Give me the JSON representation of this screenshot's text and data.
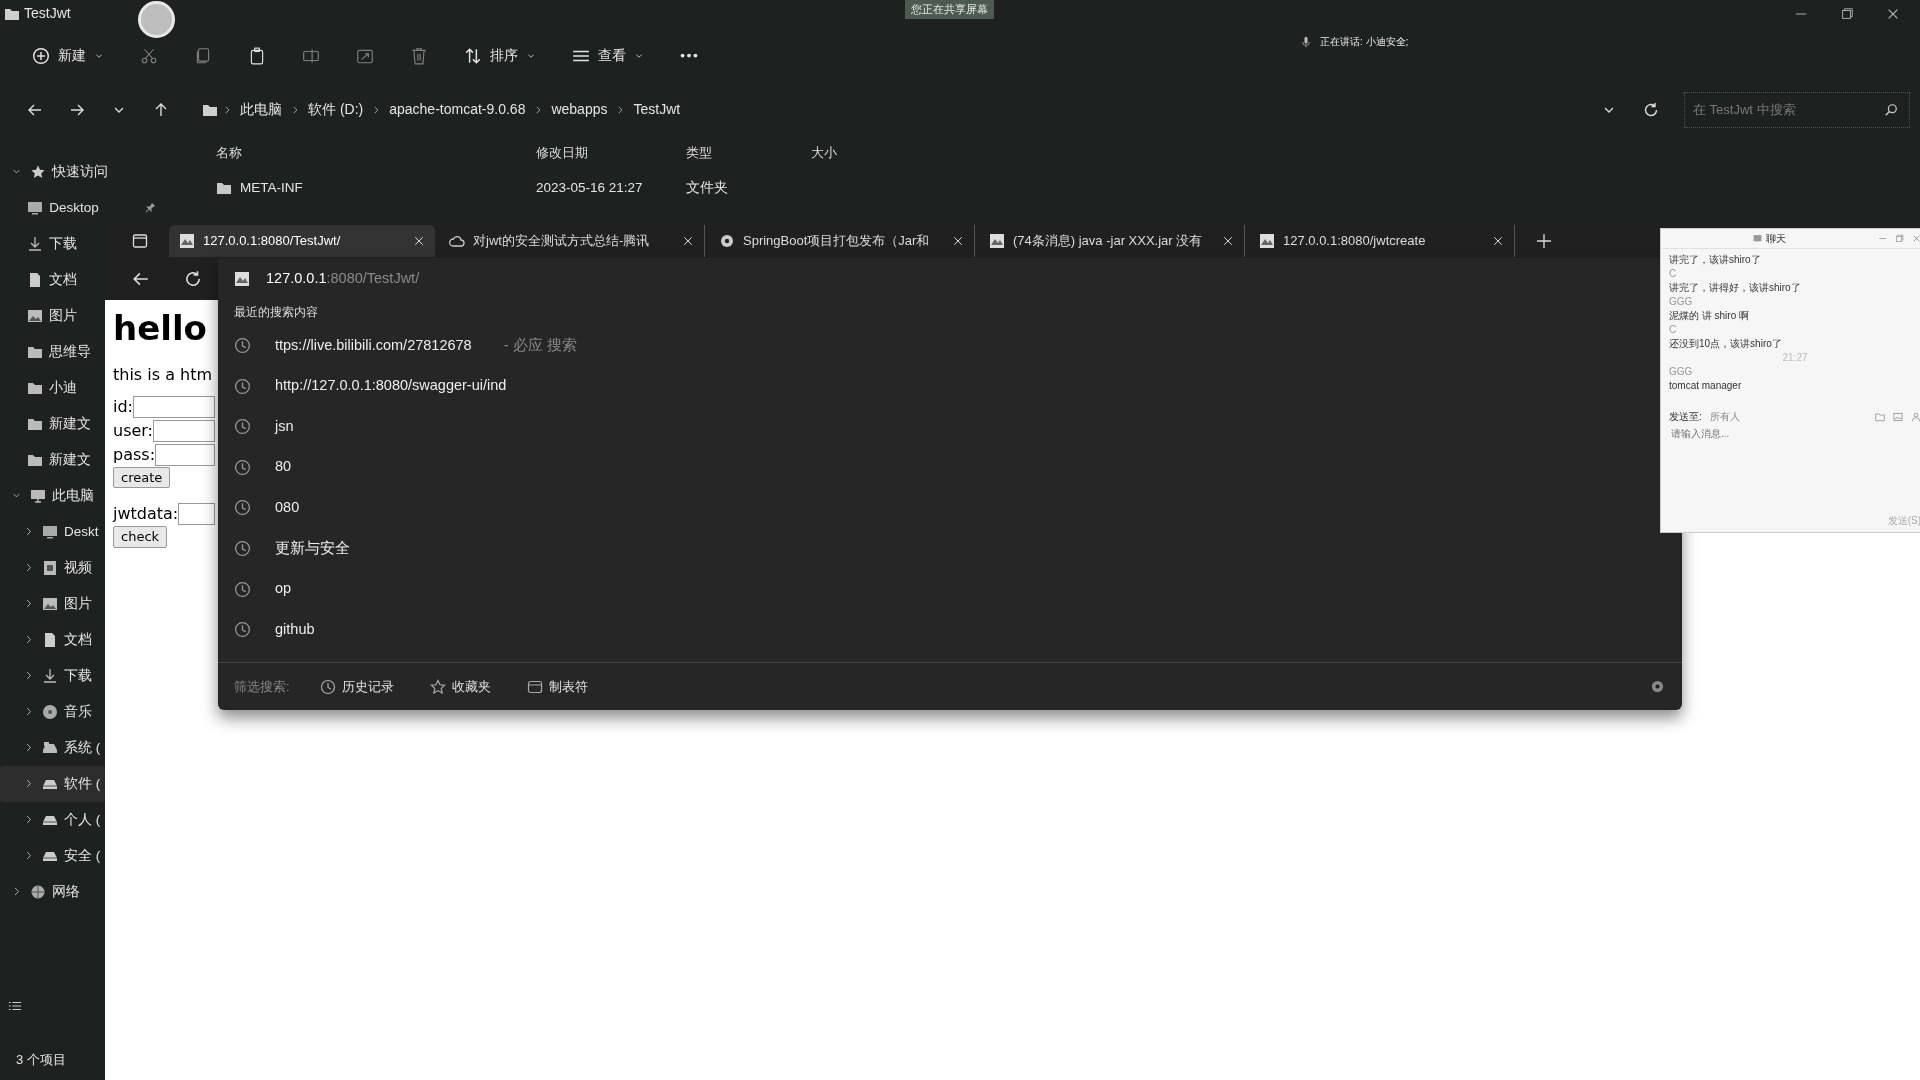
{
  "explorer": {
    "title": "TestJwt",
    "toolbar": [
      {
        "kind": "new",
        "label": "新建",
        "disabled": false
      },
      {
        "kind": "cut",
        "disabled": true
      },
      {
        "kind": "copy",
        "disabled": true
      },
      {
        "kind": "paste",
        "disabled": false
      },
      {
        "kind": "rename",
        "disabled": true
      },
      {
        "kind": "share",
        "disabled": true
      },
      {
        "kind": "delete",
        "disabled": true
      },
      {
        "kind": "sort",
        "label": "排序",
        "disabled": false
      },
      {
        "kind": "view",
        "label": "查看",
        "disabled": false
      },
      {
        "kind": "more",
        "disabled": false
      }
    ],
    "breadcrumb": [
      "此电脑",
      "软件 (D:)",
      "apache-tomcat-9.0.68",
      "webapps",
      "TestJwt"
    ],
    "search": {
      "placeholder": "在 TestJwt 中搜索"
    },
    "nav": [
      {
        "label": "快速访问",
        "kind": "star",
        "expanded": true,
        "selected": false,
        "children": [
          {
            "label": "Desktop",
            "kind": "desktop",
            "pinned": true
          },
          {
            "label": "下载",
            "kind": "download",
            "pinned": false
          },
          {
            "label": "文档",
            "kind": "doc",
            "pinned": false
          },
          {
            "label": "图片",
            "kind": "picture",
            "pinned": false
          },
          {
            "label": "思维导",
            "kind": "folder",
            "pinned": false
          },
          {
            "label": "小迪",
            "kind": "folder",
            "pinned": false
          },
          {
            "label": "新建文",
            "kind": "folder",
            "pinned": false
          },
          {
            "label": "新建文",
            "kind": "folder",
            "pinned": false
          }
        ]
      },
      {
        "label": "此电脑",
        "kind": "pc",
        "expanded": true,
        "selected": false,
        "children": [
          {
            "label": "Deskt",
            "kind": "desktop",
            "expanded": false,
            "selected": false
          },
          {
            "label": "视频",
            "kind": "video",
            "expanded": false,
            "selected": false
          },
          {
            "label": "图片",
            "kind": "picture",
            "expanded": false,
            "selected": false
          },
          {
            "label": "文档",
            "kind": "doc",
            "expanded": false,
            "selected": false
          },
          {
            "label": "下载",
            "kind": "download",
            "expanded": false,
            "selected": false
          },
          {
            "label": "音乐",
            "kind": "music",
            "expanded": false,
            "selected": false
          },
          {
            "label": "系统 (",
            "kind": "sysdrive",
            "expanded": false,
            "selected": false
          },
          {
            "label": "软件 (",
            "kind": "drive",
            "expanded": false,
            "selected": true
          },
          {
            "label": "个人 (",
            "kind": "drive",
            "expanded": false,
            "selected": false
          },
          {
            "label": "安全 (",
            "kind": "drive",
            "expanded": false,
            "selected": false
          }
        ]
      },
      {
        "label": "网络",
        "kind": "network",
        "expanded": false,
        "selected": false
      }
    ],
    "columns": [
      "名称",
      "修改日期",
      "类型",
      "大小"
    ],
    "rows": [
      {
        "name": "META-INF",
        "modified": "2023-05-16 21:27",
        "type": "文件夹"
      }
    ],
    "status": "3 个项目"
  },
  "share_banner": "您正在共享屏幕",
  "speaking": "正在讲话: 小迪安全;",
  "browser": {
    "tabs": [
      {
        "title": "127.0.0.1:8080/TestJwt/",
        "kind": "page",
        "selected": true
      },
      {
        "title": "对jwt的安全测试方式总结-腾讯",
        "kind": "cloud",
        "selected": false
      },
      {
        "title": "SpringBoot项目打包发布（Jar和",
        "kind": "gear",
        "selected": false
      },
      {
        "title": "(74条消息) java -jar XXX.jar 没有",
        "kind": "page",
        "selected": false
      },
      {
        "title": "127.0.0.1:8080/jwtcreate",
        "kind": "page",
        "selected": false
      }
    ],
    "address": {
      "host": "127.0.0.1",
      "rest": ":8080/TestJwt/"
    },
    "suggestions": {
      "heading": "最近的搜索内容",
      "items": [
        {
          "text": "ttps://live.bilibili.com/27812678",
          "suffix": "- 必应 搜索"
        },
        {
          "text": "http://127.0.0.1:8080/swagger-ui/ind"
        },
        {
          "text": "jsn"
        },
        {
          "text": "80"
        },
        {
          "text": "080"
        },
        {
          "text": "更新与安全"
        },
        {
          "text": "op"
        },
        {
          "text": "github"
        }
      ],
      "filter_label": "筛选搜索:",
      "filters": [
        {
          "kind": "history",
          "label": "历史记录"
        },
        {
          "kind": "star",
          "label": "收藏夹"
        },
        {
          "kind": "tab",
          "label": "制表符"
        }
      ]
    },
    "page": {
      "heading": "hello",
      "text": "this is a htm",
      "items": [
        {
          "kind": "field",
          "label": "id:"
        },
        {
          "kind": "field",
          "label": "user:"
        },
        {
          "kind": "field",
          "label": "pass:"
        },
        {
          "kind": "button",
          "label": "create"
        },
        {
          "kind": "field",
          "label": "jwtdata:"
        },
        {
          "kind": "button",
          "label": "check"
        }
      ]
    }
  },
  "chat": {
    "title": "聊天",
    "messages": [
      {
        "kind": "text",
        "text": "讲完了，该讲shiro了"
      },
      {
        "kind": "sender",
        "text": "C"
      },
      {
        "kind": "text",
        "text": "讲完了，讲得好，该讲shiro了"
      },
      {
        "kind": "sender",
        "text": "GGG"
      },
      {
        "kind": "text",
        "text": "泥煤的 讲 shiro 啊"
      },
      {
        "kind": "sender",
        "text": "C"
      },
      {
        "kind": "text",
        "text": "还没到10点，该讲shiro了"
      },
      {
        "kind": "time",
        "text": "21:27"
      },
      {
        "kind": "sender",
        "text": "GGG"
      },
      {
        "kind": "text",
        "text": "tomcat manager"
      }
    ],
    "send_to_label": "发送至:",
    "recipient": "所有人",
    "input": {
      "placeholder": "请输入消息..."
    },
    "send": "发送(S)"
  }
}
